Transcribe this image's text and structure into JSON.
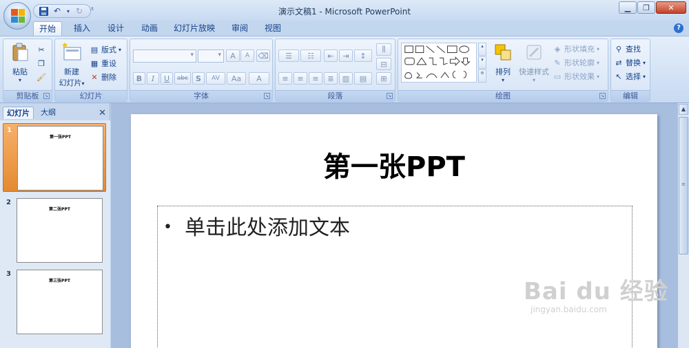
{
  "window": {
    "title": "演示文稿1 - Microsoft PowerPoint"
  },
  "tabs": [
    {
      "label": "开始",
      "active": true
    },
    {
      "label": "插入"
    },
    {
      "label": "设计"
    },
    {
      "label": "动画"
    },
    {
      "label": "幻灯片放映"
    },
    {
      "label": "审阅"
    },
    {
      "label": "视图"
    }
  ],
  "ribbon": {
    "clipboard": {
      "label": "剪贴板",
      "paste": "粘贴"
    },
    "slides": {
      "label": "幻灯片",
      "new_slide": "新建",
      "new_slide_2": "幻灯片",
      "layout": "版式",
      "reset": "重设",
      "delete": "删除"
    },
    "font": {
      "label": "字体",
      "bold": "B",
      "italic": "I",
      "underline": "U",
      "strike": "abc",
      "shadow": "S",
      "spacing": "AV",
      "case": "Aa",
      "color": "A",
      "grow": "A",
      "shrink": "A"
    },
    "paragraph": {
      "label": "段落"
    },
    "drawing": {
      "label": "绘图",
      "arrange": "排列",
      "quick_styles": "快速样式",
      "shape_fill": "形状填充",
      "shape_outline": "形状轮廓",
      "shape_effects": "形状效果"
    },
    "editing": {
      "label": "编辑",
      "find": "查找",
      "replace": "替换",
      "select": "选择"
    }
  },
  "panel": {
    "tab_slides": "幻灯片",
    "tab_outline": "大纲",
    "close": "✕",
    "thumbs": [
      {
        "num": "1",
        "title": "第一张PPT",
        "selected": true
      },
      {
        "num": "2",
        "title": "第二张PPT"
      },
      {
        "num": "3",
        "title": "第三张PPT"
      }
    ]
  },
  "slide": {
    "title": "第一张PPT",
    "placeholder": "单击此处添加文本"
  },
  "watermark": {
    "main": "Bai du 经验",
    "sub": "jingyan.baidu.com"
  },
  "colors": {
    "ribbon_bg": "#d3e2f5",
    "selected_thumb": "#e48a31",
    "workspace": "#a7bedf",
    "accent_text": "#15428b"
  }
}
